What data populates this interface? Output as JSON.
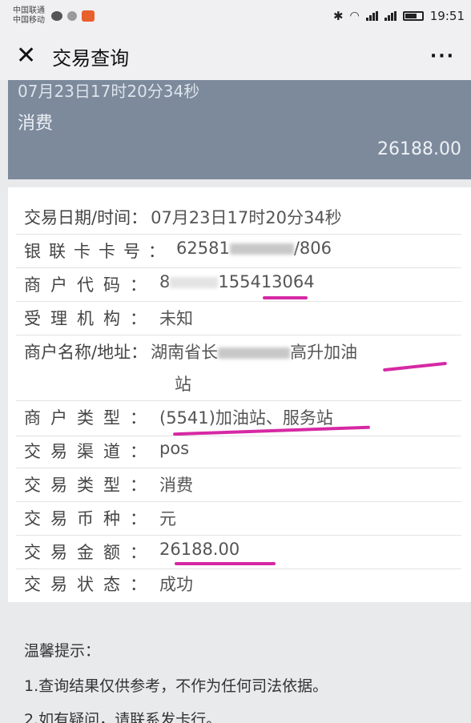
{
  "status_bar": {
    "carrier_1": "中国联通",
    "carrier_2": "中国移动",
    "time": "19:51"
  },
  "nav": {
    "close_icon": "close-icon",
    "title": "交易查询",
    "more_icon": "more-icon",
    "more_label": "···"
  },
  "header": {
    "datetime": "07月23日17时20分34秒",
    "type": "消费",
    "amount": "26188.00",
    "bg_color": "#7c8a9c"
  },
  "details": [
    {
      "label": "交易日期/时间：",
      "value": "07月23日17时20分34秒"
    },
    {
      "label": "银联卡卡号：",
      "value": "62581",
      "value_tail": "/806"
    },
    {
      "label": "商户代码：",
      "value": "8",
      "value_tail": "155413064"
    },
    {
      "label": "受理机构：",
      "value": "未知"
    },
    {
      "label": "商户名称/地址：",
      "value": "湖南省长",
      "value_tail": "高升加油",
      "value_line2": "站"
    },
    {
      "label": "商户类型：",
      "value": "(5541)加油站、服务站"
    },
    {
      "label": "交易渠道：",
      "value": "pos"
    },
    {
      "label": "交易类型：",
      "value": "消费"
    },
    {
      "label": "交易币种：",
      "value": "元"
    },
    {
      "label": "交易金额：",
      "value": "26188.00"
    },
    {
      "label": "交易状态：",
      "value": "成功"
    }
  ],
  "tips": {
    "title": "温馨提示：",
    "items": [
      "1.查询结果仅供参考，不作为任何司法依据。",
      "2.如有疑问，请联系发卡行。"
    ]
  },
  "highlight_color": "#d629a4"
}
